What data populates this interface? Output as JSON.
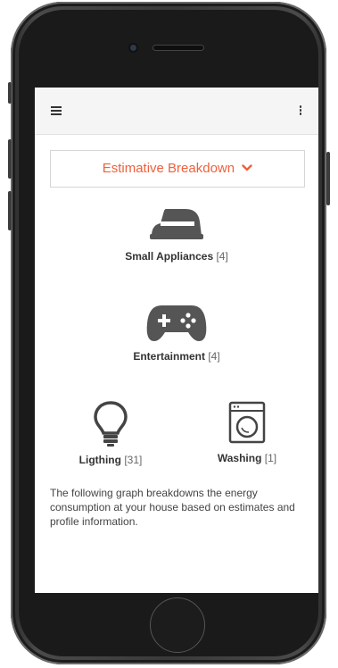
{
  "header": {
    "menu_icon": "hamburger-menu-icon",
    "more_icon": "kebab-menu-icon"
  },
  "dropdown": {
    "label": "Estimative Breakdown",
    "icon": "chevron-down-icon",
    "color": "#f0603c"
  },
  "categories": [
    {
      "name": "Small Appliances",
      "count": "[4]",
      "icon": "iron-icon"
    },
    {
      "name": "Entertainment",
      "count": "[4]",
      "icon": "gamepad-icon"
    },
    {
      "name": "Ligthing",
      "count": "[31]",
      "icon": "lightbulb-icon"
    },
    {
      "name": "Washing",
      "count": "[1]",
      "icon": "washing-machine-icon"
    }
  ],
  "description": "The following graph breakdowns the energy consumption at your house based on estimates and profile information.",
  "colors": {
    "accent": "#f0603c",
    "icon": "#555555",
    "appbar": "#f5f5f5"
  }
}
